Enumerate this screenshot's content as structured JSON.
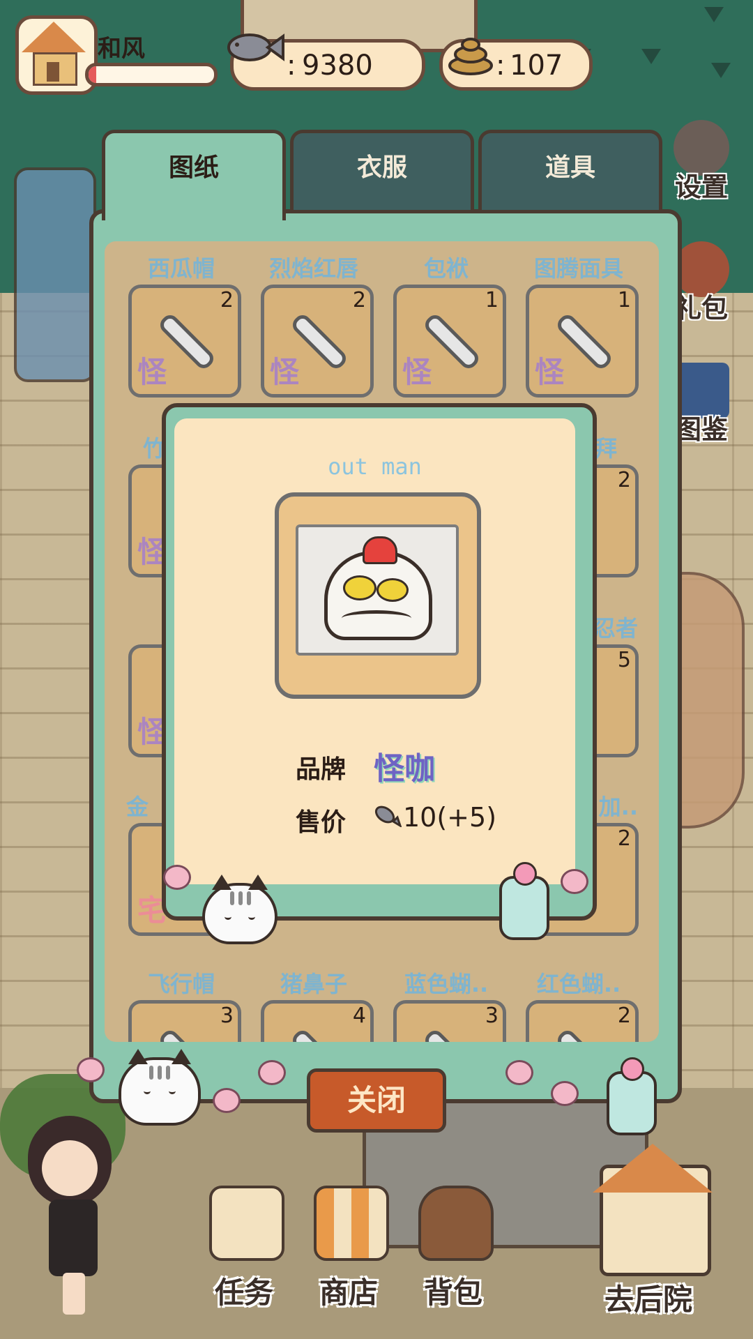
{
  "player": {
    "name": "和风",
    "exp_fraction": 0.06
  },
  "currency": {
    "fish": "9380",
    "poop": "107",
    "fish_prefix": ":",
    "poop_prefix": ":"
  },
  "side_menu": [
    {
      "label": "设置",
      "icon": "gear-icon"
    },
    {
      "label": "礼包",
      "icon": "gift-bag-icon"
    },
    {
      "label": "图鉴",
      "icon": "collection-book-icon"
    }
  ],
  "tabs": [
    {
      "label": "图纸",
      "active": true
    },
    {
      "label": "衣服",
      "active": false
    },
    {
      "label": "道具",
      "active": false
    }
  ],
  "grid": {
    "row1": [
      {
        "name": "西瓜帽",
        "count": "2",
        "brand": "怪"
      },
      {
        "name": "烈焰红唇",
        "count": "2",
        "brand": "怪"
      },
      {
        "name": "包袱",
        "count": "1",
        "brand": "怪"
      },
      {
        "name": "图腾面具",
        "count": "1",
        "brand": "怪"
      }
    ],
    "row5": [
      {
        "name": "飞行帽",
        "count": "3"
      },
      {
        "name": "猪鼻子",
        "count": "4"
      },
      {
        "name": "蓝色蝴..",
        "count": "3"
      },
      {
        "name": "红色蝴..",
        "count": "2"
      }
    ],
    "peek": {
      "r2_left_name": "竹",
      "r2_right_name": "拜",
      "r2_right_count": "2",
      "r3_right_name": "忍者",
      "r3_right_count": "5",
      "r4_left_name": "金",
      "r4_right_name": "加..",
      "r4_right_count": "2",
      "r2_brand": "怪",
      "r3_brand": "怪",
      "r4_brand": "宅"
    }
  },
  "modal": {
    "title": "out man",
    "brand_label": "品牌",
    "brand_value": "怪咖",
    "price_label": "售价",
    "price_value": "10(+5)"
  },
  "close_button": "关闭",
  "bottom_nav": [
    {
      "label": "任务",
      "icon": "task-clipboard-icon"
    },
    {
      "label": "商店",
      "icon": "shop-icon"
    },
    {
      "label": "背包",
      "icon": "backpack-icon"
    },
    {
      "label": "去后院",
      "icon": "backyard-house-icon"
    }
  ],
  "colors": {
    "panel": "#8bc7ae",
    "accent_close": "#c75a2a",
    "brand_text": "#6e63c4",
    "item_name": "#7fb4cf"
  }
}
